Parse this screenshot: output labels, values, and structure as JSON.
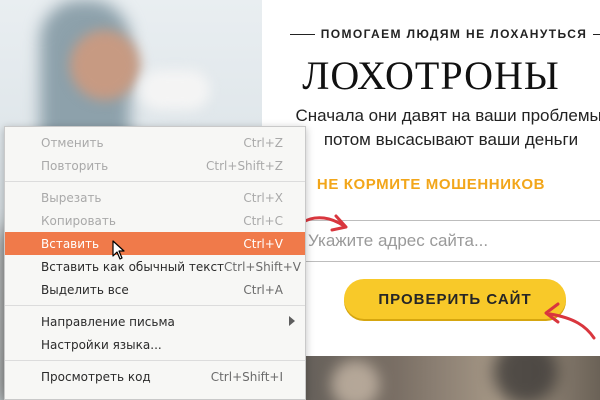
{
  "hero": {
    "tagline": "ПОМОГАЕМ ЛЮДЯМ НЕ ЛОХАНУТЬСЯ",
    "headline": "ЛОХОТРОНЫ",
    "subtext": "Сначала они давят на ваши проблемы, потом высасывают ваши деньги",
    "warning": "НЕ КОРМИТЕ МОШЕННИКОВ",
    "url_placeholder": "Укажите адрес сайта...",
    "check_button": "ПРОВЕРИТЬ САЙТ",
    "accent_color": "#f8c929",
    "warning_color": "#f2a61a",
    "arrow_color": "#d9363e"
  },
  "context_menu": {
    "highlight_color": "#f07a4a",
    "items": [
      {
        "label": "Отменить",
        "shortcut": "Ctrl+Z",
        "disabled": true
      },
      {
        "label": "Повторить",
        "shortcut": "Ctrl+Shift+Z",
        "disabled": true
      },
      {
        "label": "Вырезать",
        "shortcut": "Ctrl+X",
        "disabled": true
      },
      {
        "label": "Копировать",
        "shortcut": "Ctrl+C",
        "disabled": true
      },
      {
        "label": "Вставить",
        "shortcut": "Ctrl+V",
        "highlighted": true
      },
      {
        "label": "Вставить как обычный текст",
        "shortcut": "Ctrl+Shift+V"
      },
      {
        "label": "Выделить все",
        "shortcut": "Ctrl+A"
      },
      {
        "label": "Направление письма",
        "submenu": true
      },
      {
        "label": "Настройки языка..."
      },
      {
        "label": "Просмотреть код",
        "shortcut": "Ctrl+Shift+I"
      }
    ]
  }
}
